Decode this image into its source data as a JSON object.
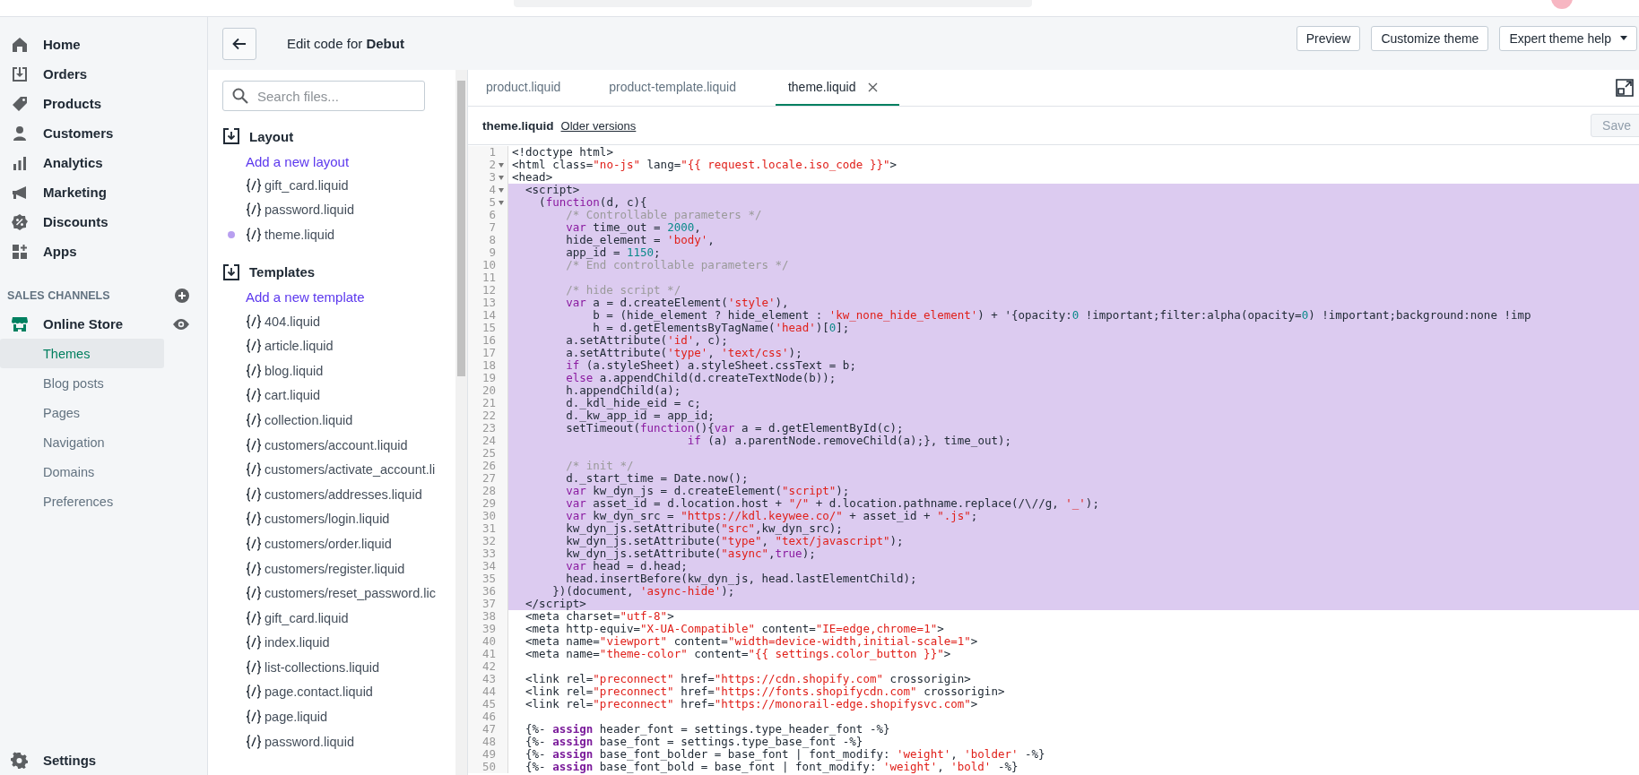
{
  "nav": {
    "items": [
      {
        "label": "Home"
      },
      {
        "label": "Orders"
      },
      {
        "label": "Products"
      },
      {
        "label": "Customers"
      },
      {
        "label": "Analytics"
      },
      {
        "label": "Marketing"
      },
      {
        "label": "Discounts"
      },
      {
        "label": "Apps"
      }
    ],
    "channels_heading": "SALES CHANNELS",
    "store": {
      "label": "Online Store"
    },
    "sub_items": [
      {
        "label": "Themes",
        "selected": true
      },
      {
        "label": "Blog posts",
        "selected": false
      },
      {
        "label": "Pages",
        "selected": false
      },
      {
        "label": "Navigation",
        "selected": false
      },
      {
        "label": "Domains",
        "selected": false
      },
      {
        "label": "Preferences",
        "selected": false
      }
    ],
    "settings": "Settings"
  },
  "header": {
    "title": "Edit code for **Debut**"
  },
  "actions": [
    {
      "label": "Preview",
      "dropdown": false
    },
    {
      "label": "Customize theme",
      "dropdown": false
    },
    {
      "label": "Expert theme help",
      "dropdown": true
    }
  ],
  "file_panel": {
    "search_placeholder": "Search files...",
    "sections": [
      {
        "title": "Layout",
        "add_link": "Add a new layout",
        "files": [
          {
            "name": "gift_card.liquid",
            "modified": false
          },
          {
            "name": "password.liquid",
            "modified": false
          },
          {
            "name": "theme.liquid",
            "modified": true
          }
        ]
      },
      {
        "title": "Templates",
        "add_link": "Add a new template",
        "files": [
          {
            "name": "404.liquid",
            "modified": false
          },
          {
            "name": "article.liquid",
            "modified": false
          },
          {
            "name": "blog.liquid",
            "modified": false
          },
          {
            "name": "cart.liquid",
            "modified": false
          },
          {
            "name": "collection.liquid",
            "modified": false
          },
          {
            "name": "customers/account.liquid",
            "modified": false
          },
          {
            "name": "customers/activate_account.li",
            "modified": false
          },
          {
            "name": "customers/addresses.liquid",
            "modified": false
          },
          {
            "name": "customers/login.liquid",
            "modified": false
          },
          {
            "name": "customers/order.liquid",
            "modified": false
          },
          {
            "name": "customers/register.liquid",
            "modified": false
          },
          {
            "name": "customers/reset_password.lic",
            "modified": false
          },
          {
            "name": "gift_card.liquid",
            "modified": false
          },
          {
            "name": "index.liquid",
            "modified": false
          },
          {
            "name": "list-collections.liquid",
            "modified": false
          },
          {
            "name": "page.contact.liquid",
            "modified": false
          },
          {
            "name": "page.liquid",
            "modified": false
          },
          {
            "name": "password.liquid",
            "modified": false
          }
        ]
      }
    ]
  },
  "tabs": [
    {
      "label": "product.liquid",
      "selected": false,
      "closable": false
    },
    {
      "label": "product-template.liquid",
      "selected": false,
      "closable": false
    },
    {
      "label": "theme.liquid",
      "selected": true,
      "closable": true
    }
  ],
  "file_bar": {
    "name": "theme.liquid",
    "link": "Older versions",
    "save": {
      "label": "Save",
      "disabled": true
    }
  },
  "editor": {
    "lines": [
      {
        "n": "1",
        "text": "<!doctype html>",
        "foldable": false,
        "selected": false
      },
      {
        "n": "2",
        "text": "<html class=\"no-js\" lang=\"{{ request.locale.iso_code }}\">",
        "foldable": true,
        "selected": false
      },
      {
        "n": "3",
        "text": "<head>",
        "foldable": true,
        "selected": false
      },
      {
        "n": "4",
        "text": "  <script>",
        "foldable": true,
        "selected": true
      },
      {
        "n": "5",
        "text": "    (function(d, c){",
        "foldable": true,
        "selected": true
      },
      {
        "n": "6",
        "text": "        /* Controllable parameters */",
        "foldable": false,
        "selected": true
      },
      {
        "n": "7",
        "text": "        var time_out = 2000,",
        "foldable": false,
        "selected": true
      },
      {
        "n": "8",
        "text": "        hide_element = 'body',",
        "foldable": false,
        "selected": true
      },
      {
        "n": "9",
        "text": "        app_id = 1150;",
        "foldable": false,
        "selected": true
      },
      {
        "n": "10",
        "text": "        /* End controllable parameters */",
        "foldable": false,
        "selected": true
      },
      {
        "n": "11",
        "foldable": false,
        "selected": true
      },
      {
        "n": "12",
        "text": "        /* hide script */",
        "foldable": false,
        "selected": true
      },
      {
        "n": "13",
        "text": "        var a = d.createElement('style'),",
        "foldable": false,
        "selected": true
      },
      {
        "n": "14",
        "text": "            b = (hide_element ? hide_element : 'kw_none_hide_element') + '{opacity:0 !important;filter:alpha(opacity=0) !important;background:none !imp",
        "foldable": false,
        "selected": true
      },
      {
        "n": "15",
        "text": "            h = d.getElementsByTagName('head')[0];",
        "foldable": false,
        "selected": true
      },
      {
        "n": "16",
        "text": "        a.setAttribute('id', c);",
        "foldable": false,
        "selected": true
      },
      {
        "n": "17",
        "text": "        a.setAttribute('type', 'text/css');",
        "foldable": false,
        "selected": true
      },
      {
        "n": "18",
        "text": "        if (a.styleSheet) a.styleSheet.cssText = b;",
        "foldable": false,
        "selected": true
      },
      {
        "n": "19",
        "text": "        else a.appendChild(d.createTextNode(b));",
        "foldable": false,
        "selected": true
      },
      {
        "n": "20",
        "text": "        h.appendChild(a);",
        "foldable": false,
        "selected": true
      },
      {
        "n": "21",
        "text": "        d._kdl_hide_eid = c;",
        "foldable": false,
        "selected": true
      },
      {
        "n": "22",
        "text": "        d._kw_app_id = app_id;",
        "foldable": false,
        "selected": true
      },
      {
        "n": "23",
        "text": "        setTimeout(function(){var a = d.getElementById(c);",
        "foldable": false,
        "selected": true
      },
      {
        "n": "24",
        "text": "                          if (a) a.parentNode.removeChild(a);}, time_out);",
        "foldable": false,
        "selected": true
      },
      {
        "n": "25",
        "foldable": false,
        "selected": true
      },
      {
        "n": "26",
        "text": "        /* init */",
        "foldable": false,
        "selected": true
      },
      {
        "n": "27",
        "text": "        d._start_time = Date.now();",
        "foldable": false,
        "selected": true
      },
      {
        "n": "28",
        "text": "        var kw_dyn_js = d.createElement(\"script\");",
        "foldable": false,
        "selected": true
      },
      {
        "n": "29",
        "text": "        var asset_id = d.location.host + \"/\" + d.location.pathname.replace(/\\//g, '_');",
        "foldable": false,
        "selected": true
      },
      {
        "n": "30",
        "text": "        var kw_dyn_src = \"https://kdl.keywee.co/\" + asset_id + \".js\";",
        "foldable": false,
        "selected": true
      },
      {
        "n": "31",
        "text": "        kw_dyn_js.setAttribute(\"src\",kw_dyn_src);",
        "foldable": false,
        "selected": true
      },
      {
        "n": "32",
        "text": "        kw_dyn_js.setAttribute(\"type\", \"text/javascript\");",
        "foldable": false,
        "selected": true
      },
      {
        "n": "33",
        "text": "        kw_dyn_js.setAttribute(\"async\",true);",
        "foldable": false,
        "selected": true
      },
      {
        "n": "34",
        "text": "        var head = d.head;",
        "foldable": false,
        "selected": true
      },
      {
        "n": "35",
        "text": "        head.insertBefore(kw_dyn_js, head.lastElementChild);",
        "foldable": false,
        "selected": true
      },
      {
        "n": "36",
        "text": "      })(document, 'async-hide');",
        "foldable": false,
        "selected": true
      },
      {
        "n": "37",
        "text": "  </script>",
        "foldable": false,
        "selected": true
      },
      {
        "n": "38",
        "text": "  <meta charset=\"utf-8\">",
        "foldable": false,
        "selected": false
      },
      {
        "n": "39",
        "text": "  <meta http-equiv=\"X-UA-Compatible\" content=\"IE=edge,chrome=1\">",
        "foldable": false,
        "selected": false
      },
      {
        "n": "40",
        "text": "  <meta name=\"viewport\" content=\"width=device-width,initial-scale=1\">",
        "foldable": false,
        "selected": false
      },
      {
        "n": "41",
        "text": "  <meta name=\"theme-color\" content=\"{{ settings.color_button }}\">",
        "foldable": false,
        "selected": false
      },
      {
        "n": "42",
        "foldable": false,
        "selected": false
      },
      {
        "n": "43",
        "text": "  <link rel=\"preconnect\" href=\"https://cdn.shopify.com\" crossorigin>",
        "foldable": false,
        "selected": false
      },
      {
        "n": "44",
        "text": "  <link rel=\"preconnect\" href=\"https://fonts.shopifycdn.com\" crossorigin>",
        "foldable": false,
        "selected": false
      },
      {
        "n": "45",
        "text": "  <link rel=\"preconnect\" href=\"https://monorail-edge.shopifysvc.com\">",
        "foldable": false,
        "selected": false
      },
      {
        "n": "46",
        "foldable": false,
        "selected": false
      },
      {
        "n": "47",
        "text": "  {%- assign header_font = settings.type_header_font -%}",
        "foldable": false,
        "selected": false
      },
      {
        "n": "48",
        "text": "  {%- assign base_font = settings.type_base_font -%}",
        "foldable": false,
        "selected": false
      },
      {
        "n": "49",
        "text": "  {%- assign base_font_bolder = base_font | font_modify: 'weight', 'bolder' -%}",
        "foldable": false,
        "selected": false
      },
      {
        "n": "50",
        "text": "  {%- assign base_font_bold = base_font | font_modify: 'weight', 'bold' -%}",
        "foldable": false,
        "selected": false
      }
    ]
  }
}
